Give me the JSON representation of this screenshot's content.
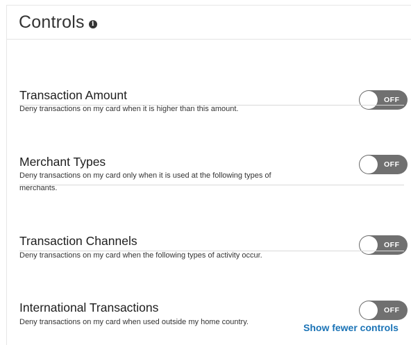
{
  "header": {
    "title": "Controls",
    "info_icon": "i"
  },
  "controls": [
    {
      "title": "Transaction Amount",
      "description": "Deny transactions on my card when it is higher than this amount.",
      "state": "OFF"
    },
    {
      "title": "Merchant Types",
      "description": "Deny transactions on my card only when it is used at the following types of merchants.",
      "state": "OFF"
    },
    {
      "title": "Transaction Channels",
      "description": "Deny transactions on my card when the following types of activity occur.",
      "state": "OFF"
    },
    {
      "title": "International Transactions",
      "description": "Deny transactions on my card when used outside my home country.",
      "state": "OFF"
    }
  ],
  "footer": {
    "link_label": "Show fewer controls"
  },
  "colors": {
    "toggle_off": "#707070",
    "link": "#1a73b6"
  }
}
